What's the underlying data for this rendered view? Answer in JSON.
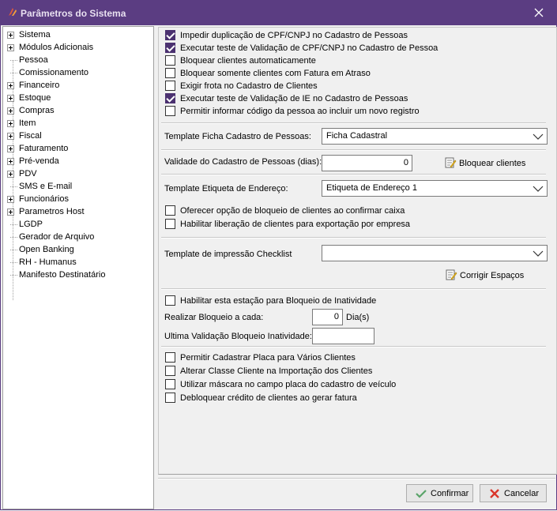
{
  "window": {
    "title": "Parâmetros do Sistema",
    "close_icon": "close-icon",
    "app_icon": "app-logo-icon"
  },
  "tree": {
    "items": [
      {
        "label": "Sistema",
        "expandable": true
      },
      {
        "label": "Módulos Adicionais",
        "expandable": true
      },
      {
        "label": "Pessoa",
        "expandable": false
      },
      {
        "label": "Comissionamento",
        "expandable": false
      },
      {
        "label": "Financeiro",
        "expandable": true
      },
      {
        "label": "Estoque",
        "expandable": true
      },
      {
        "label": "Compras",
        "expandable": true
      },
      {
        "label": "Item",
        "expandable": true
      },
      {
        "label": "Fiscal",
        "expandable": true
      },
      {
        "label": "Faturamento",
        "expandable": true
      },
      {
        "label": "Pré-venda",
        "expandable": true
      },
      {
        "label": "PDV",
        "expandable": true
      },
      {
        "label": "SMS e E-mail",
        "expandable": false
      },
      {
        "label": "Funcionários",
        "expandable": true
      },
      {
        "label": "Parametros Host",
        "expandable": true
      },
      {
        "label": "LGDP",
        "expandable": false
      },
      {
        "label": "Gerador de Arquivo",
        "expandable": false
      },
      {
        "label": "Open Banking",
        "expandable": false
      },
      {
        "label": "RH - Humanus",
        "expandable": false
      },
      {
        "label": "Manifesto Destinatário",
        "expandable": false
      }
    ]
  },
  "checks_top": [
    {
      "label": "Impedir duplicação de CPF/CNPJ no Cadastro de Pessoas",
      "checked": true
    },
    {
      "label": "Executar teste de Validação de CPF/CNPJ no Cadastro de Pessoa",
      "checked": true
    },
    {
      "label": "Bloquear clientes automaticamente",
      "checked": false
    },
    {
      "label": "Bloquear somente clientes com Fatura em Atraso",
      "checked": false
    },
    {
      "label": "Exigir frota no Cadastro de Clientes",
      "checked": false
    },
    {
      "label": "Executar teste de Validação de IE no Cadastro de Pessoas",
      "checked": true
    },
    {
      "label": "Permitir informar código da pessoa ao incluir um novo registro",
      "checked": false
    }
  ],
  "ficha": {
    "label": "Template Ficha Cadastro de Pessoas:",
    "value": "Ficha Cadastral"
  },
  "validade": {
    "label": "Validade do Cadastro de Pessoas (dias):",
    "value": "0",
    "button": "Bloquear clientes"
  },
  "etiqueta": {
    "label": "Template Etiqueta de Endereço:",
    "value": "Etiqueta de Endereço 1"
  },
  "checks_mid": [
    {
      "label": "Oferecer opção de bloqueio de clientes ao confirmar caixa",
      "checked": false
    },
    {
      "label": "Habilitar liberação de clientes para exportação por empresa",
      "checked": false
    }
  ],
  "checklist": {
    "label": "Template de impressão Checklist",
    "value": "",
    "button": "Corrigir Espaços"
  },
  "inatividade": {
    "check": {
      "label": "Habilitar esta estação para Bloqueio de Inatividade",
      "checked": false
    },
    "cada_label": "Realizar Bloqueio a cada:",
    "cada_value": "0",
    "cada_unit": "Dia(s)",
    "ultima_label": "Ultima Validação Bloqueio Inatividade:",
    "ultima_value": ""
  },
  "checks_bottom": [
    {
      "label": "Permitir Cadastrar Placa para Vários Clientes",
      "checked": false
    },
    {
      "label": "Alterar Classe Cliente na Importação dos Clientes",
      "checked": false
    },
    {
      "label": "Utilizar máscara no campo placa do cadastro de veículo",
      "checked": false
    },
    {
      "label": "Debloquear crédito de clientes ao gerar fatura",
      "checked": false
    }
  ],
  "footer": {
    "confirm": "Confirmar",
    "cancel": "Cancelar"
  },
  "colors": {
    "titlebar": "#5b3d82",
    "check_fill": "#4b3170",
    "confirm_icon": "#5aa469",
    "cancel_icon": "#d9362b"
  }
}
